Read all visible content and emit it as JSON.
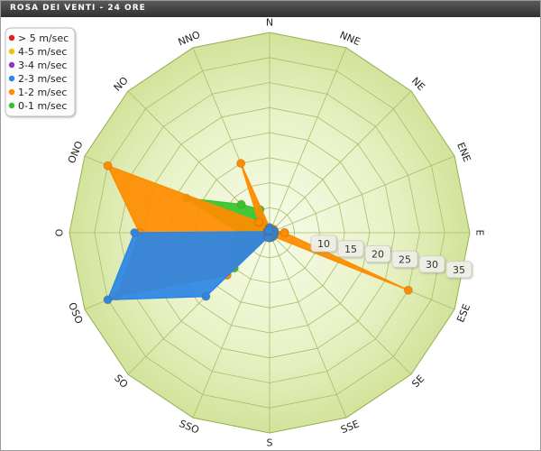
{
  "title": "ROSA DEI VENTI - 24 ORE",
  "chart_data": {
    "type": "radar",
    "directions": [
      "N",
      "NNE",
      "NE",
      "ENE",
      "E",
      "ESE",
      "SE",
      "SSE",
      "S",
      "SSO",
      "SO",
      "OSO",
      "O",
      "ONO",
      "NO",
      "NNO"
    ],
    "radial_ticks": [
      "10",
      "15",
      "20",
      "25",
      "30",
      "35"
    ],
    "rmax": 40,
    "grid": true,
    "legend_position": "top-left",
    "series": [
      {
        "name": "> 5 m/sec",
        "color": "#e0201c",
        "values": [
          0,
          0,
          0,
          0,
          0,
          0,
          0,
          0,
          0,
          0,
          0,
          0,
          0,
          0,
          0,
          0
        ]
      },
      {
        "name": "4-5 m/sec",
        "color": "#ecc417",
        "values": [
          0,
          0,
          0,
          0,
          0,
          0,
          0,
          0,
          0,
          0,
          0,
          0,
          0,
          0,
          0,
          0
        ]
      },
      {
        "name": "3-4 m/sec",
        "color": "#8c35c8",
        "values": [
          0,
          0,
          0,
          0,
          0,
          0,
          0,
          0,
          0,
          0,
          0,
          0,
          0,
          0,
          0,
          0
        ]
      },
      {
        "name": "2-3 m/sec",
        "color": "#2b86e6",
        "values": [
          1,
          0.3,
          0.3,
          1,
          1,
          1,
          1,
          1,
          1,
          1,
          18,
          35,
          27,
          0.5,
          0.5,
          0.5
        ]
      },
      {
        "name": "1-2 m/sec",
        "color": "#ff8c00",
        "values": [
          1,
          0.5,
          1,
          1,
          3,
          30,
          1,
          1,
          1,
          1,
          12,
          33,
          26,
          35,
          3,
          15
        ]
      },
      {
        "name": "0-1 m/sec",
        "color": "#36c22e",
        "values": [
          0,
          0.5,
          1,
          1,
          3,
          1,
          0.5,
          1,
          1,
          1,
          10,
          10,
          6,
          18,
          8,
          5
        ]
      }
    ]
  }
}
